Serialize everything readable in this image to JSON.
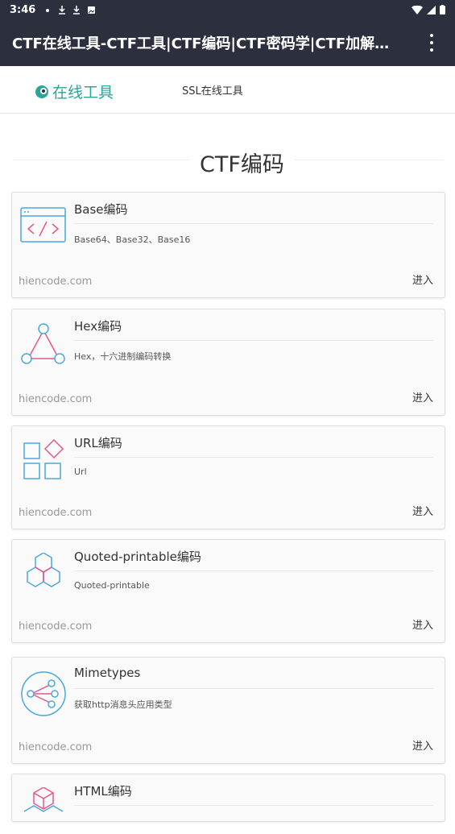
{
  "status_bar": {
    "time": "3:46"
  },
  "app_bar": {
    "title": "CTF在线工具-CTF工具|CTF编码|CTF密码学|CTF加解密|..."
  },
  "site_nav": {
    "logo_text": "在线工具",
    "link": "SSL在线工具"
  },
  "section": {
    "title": "CTF编码"
  },
  "cards": [
    {
      "name": "Base编码",
      "desc": "Base64、Base32、Base16",
      "domain": "hiencode.com",
      "enter": "进入"
    },
    {
      "name": "Hex编码",
      "desc": "Hex，十六进制编码转换",
      "domain": "hiencode.com",
      "enter": "进入"
    },
    {
      "name": "URL编码",
      "desc": "Url",
      "domain": "hiencode.com",
      "enter": "进入"
    },
    {
      "name": "Quoted-printable编码",
      "desc": "Quoted-printable",
      "domain": "hiencode.com",
      "enter": "进入"
    },
    {
      "name": "Mimetypes",
      "desc": "获取http消息头应用类型",
      "domain": "hiencode.com",
      "enter": "进入"
    },
    {
      "name": "HTML编码",
      "desc": "",
      "domain": "",
      "enter": ""
    }
  ],
  "colors": {
    "bar": "#2b2f3e",
    "accent": "#2aa59a",
    "icon_blue": "#4aa8e0",
    "icon_pink": "#e8568a"
  }
}
